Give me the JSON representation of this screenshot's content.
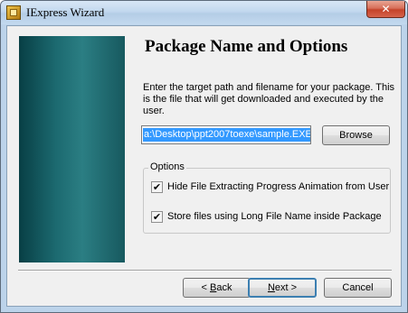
{
  "window": {
    "title": "IExpress Wizard",
    "close_glyph": "✕"
  },
  "page": {
    "heading": "Package Name and Options",
    "description": "Enter the target path and filename for your package. This is the file that will get downloaded and executed by the user."
  },
  "path_field": {
    "value": "a:\\Desktop\\ppt2007toexe\\sample.EXE"
  },
  "browse_button": {
    "label": "Browse"
  },
  "options": {
    "title": "Options",
    "items": [
      {
        "label": "Hide File Extracting Progress Animation from User",
        "checked": true,
        "mark": "✔"
      },
      {
        "label": "Store files using Long File Name inside Package",
        "checked": true,
        "mark": "✔"
      }
    ]
  },
  "nav": {
    "back_prefix": "< ",
    "back_access": "B",
    "back_rest": "ack",
    "next_access": "N",
    "next_rest": "ext >",
    "cancel": "Cancel"
  },
  "colors": {
    "side_panel": "#1c6a70",
    "selection": "#3399ff",
    "title_bar": "#c2d8ee",
    "close_button": "#c4432a"
  }
}
